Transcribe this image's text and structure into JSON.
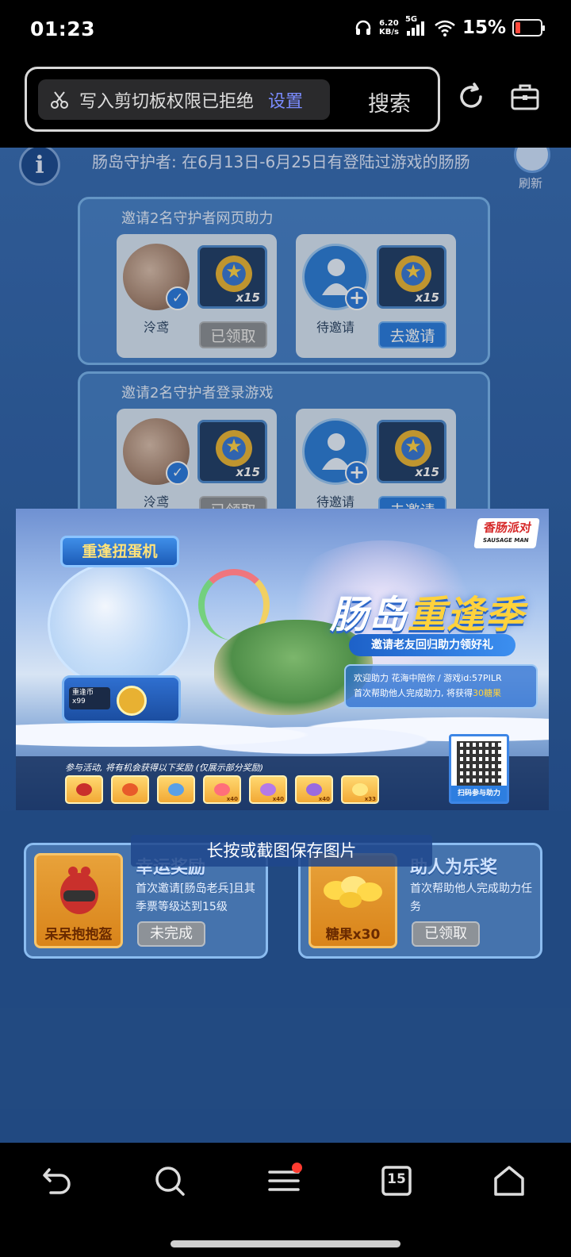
{
  "status_bar": {
    "time": "01:23",
    "net_speed_value": "6.20",
    "net_speed_unit": "KB/s",
    "network": "5G",
    "battery": "15%"
  },
  "browser": {
    "toast_text": "写入剪切板权限已拒绝",
    "toast_action": "设置",
    "search_label": "搜索"
  },
  "page": {
    "guardian_note": "肠岛守护者: 在6月13日-6月25日有登陆过游戏的肠肠",
    "refresh_label": "刷新",
    "info_symbol": "i",
    "tasks": [
      {
        "title": "邀请2名守护者网页助力",
        "slots": [
          {
            "name": "泠鸢",
            "reward_count": "x15",
            "button": "已领取",
            "state": "claimed"
          },
          {
            "name": "待邀请",
            "reward_count": "x15",
            "button": "去邀请",
            "state": "invite"
          }
        ]
      },
      {
        "title": "邀请2名守护者登录游戏",
        "slots": [
          {
            "name": "泠鸢",
            "reward_count": "x15",
            "button": "已领取",
            "state": "claimed"
          },
          {
            "name": "待邀请",
            "reward_count": "x15",
            "button": "去邀请",
            "state": "invite"
          }
        ]
      }
    ]
  },
  "poster": {
    "machine_sign": "重逢扭蛋机",
    "machine_counter_label": "重逢币",
    "machine_counter_value": "x99",
    "game_logo": "香肠派对",
    "game_logo_en": "SAUSAGE MAN",
    "title_part1": "肠岛",
    "title_part2": "重逢季",
    "subtitle": "邀请老友回归助力领好礼",
    "welcome_line1": "欢迎助力 花海中陪你 / 游戏id:57PILR",
    "welcome_line2_prefix": "首次帮助他人完成助力, 将获得",
    "welcome_line2_highlight": "30糖果",
    "strip_label": "参与活动, 将有机会获得以下奖励 (仅展示部分奖励)",
    "strip_items": [
      "",
      "",
      "",
      "x40",
      "x40",
      "x40",
      "x33"
    ],
    "qr_label": "扫码参与助力"
  },
  "save_hint": "长按或截图保存图片",
  "prizes": [
    {
      "title": "幸运奖励",
      "item_name": "呆呆抱抱盔",
      "description": "首次邀请[肠岛老兵]且其季票等级达到15级",
      "status": "未完成"
    },
    {
      "title": "助人为乐奖",
      "item_name": "糖果x30",
      "description": "首次帮助他人完成助力任务",
      "status": "已领取"
    }
  ],
  "nav": {
    "tab_count": "15"
  },
  "colors": {
    "page_blue": "#2b5c9e",
    "accent_yellow": "#ffd23c",
    "invite_blue": "#2d7ee0",
    "notification_red": "#ff3b30"
  },
  "icons": [
    "scissors-icon",
    "refresh-icon",
    "toolbox-icon",
    "back-icon",
    "search-icon",
    "menu-icon",
    "tabs-icon",
    "home-icon",
    "headphones-icon",
    "signal-icon",
    "wifi-icon",
    "battery-icon"
  ]
}
